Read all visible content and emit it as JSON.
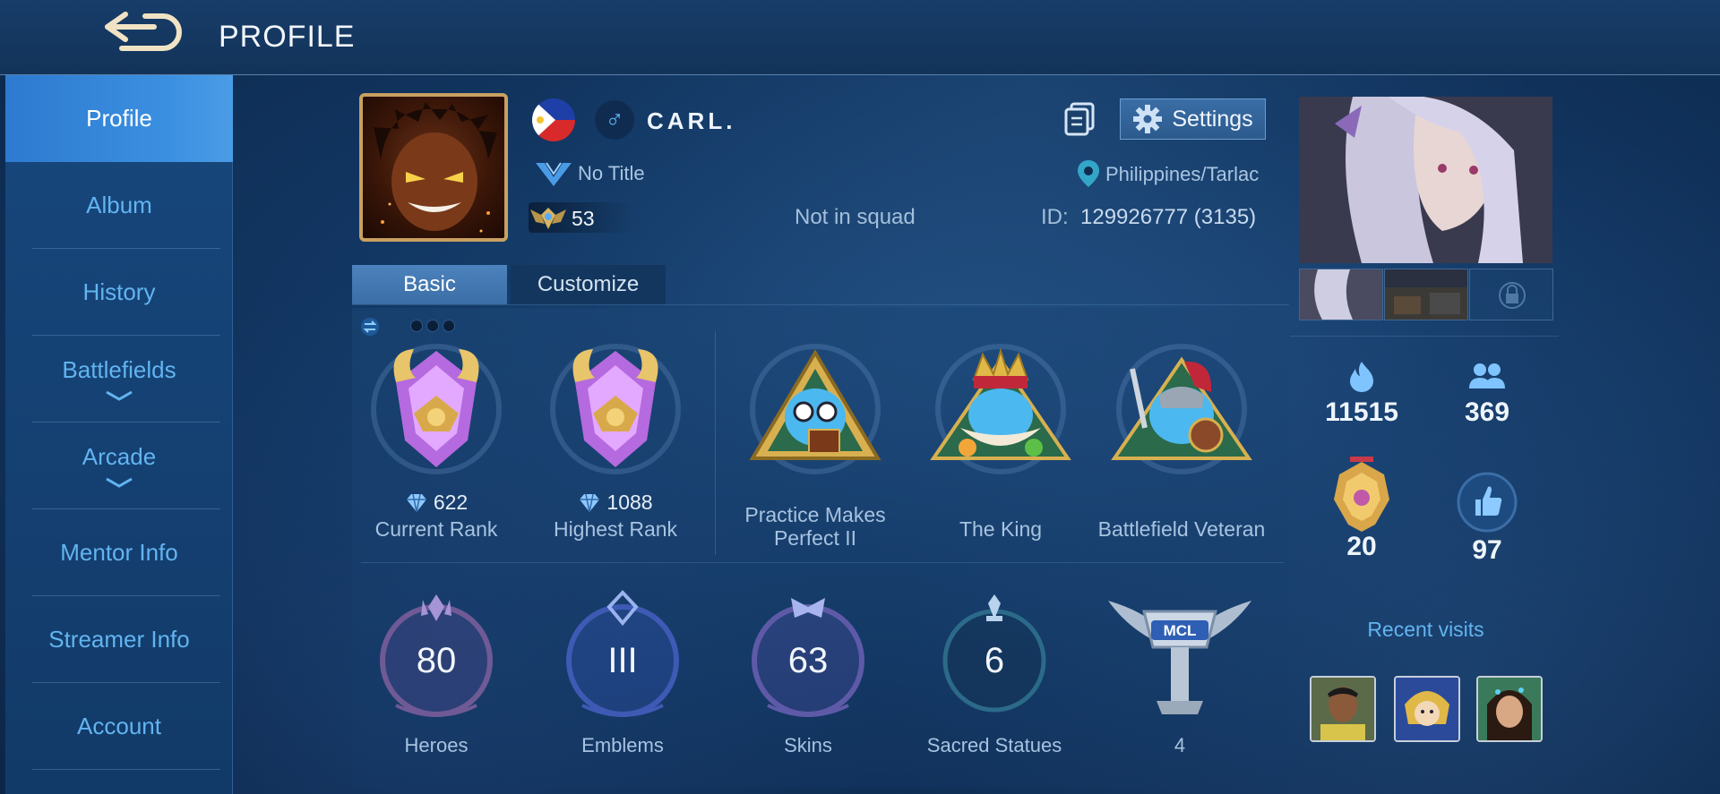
{
  "header": {
    "title": "PROFILE"
  },
  "sidebar": {
    "items": [
      {
        "label": "Profile"
      },
      {
        "label": "Album"
      },
      {
        "label": "History"
      },
      {
        "label": "Battlefields"
      },
      {
        "label": "Arcade"
      },
      {
        "label": "Mentor Info"
      },
      {
        "label": "Streamer Info"
      },
      {
        "label": "Account"
      }
    ]
  },
  "player": {
    "name": "CARL.",
    "gender_symbol": "♂",
    "title": "No Title",
    "level": "53",
    "squad": "Not in squad",
    "location": "Philippines/Tarlac",
    "id_label": "ID:",
    "id_value": "129926777 (3135)"
  },
  "toolbar": {
    "settings_label": "Settings"
  },
  "tabs": {
    "basic": "Basic",
    "customize": "Customize"
  },
  "achievements": [
    {
      "value": "622",
      "label": "Current Rank"
    },
    {
      "value": "1088",
      "label": "Highest Rank"
    },
    {
      "label": "Practice Makes Perfect II"
    },
    {
      "label": "The King"
    },
    {
      "label": "Battlefield Veteran"
    }
  ],
  "stats": [
    {
      "value": "80",
      "label": "Heroes"
    },
    {
      "value": "III",
      "label": "Emblems"
    },
    {
      "value": "63",
      "label": "Skins"
    },
    {
      "value": "6",
      "label": "Sacred Statues"
    },
    {
      "logo_text": "MCL",
      "value": "4"
    }
  ],
  "right_stats": {
    "popularity": "11515",
    "friends": "369",
    "medal": "20",
    "likes": "97"
  },
  "recent": {
    "title": "Recent visits"
  },
  "colors": {
    "accent": "#62b4f0",
    "panel": "#123763",
    "gold": "#c9a060"
  }
}
